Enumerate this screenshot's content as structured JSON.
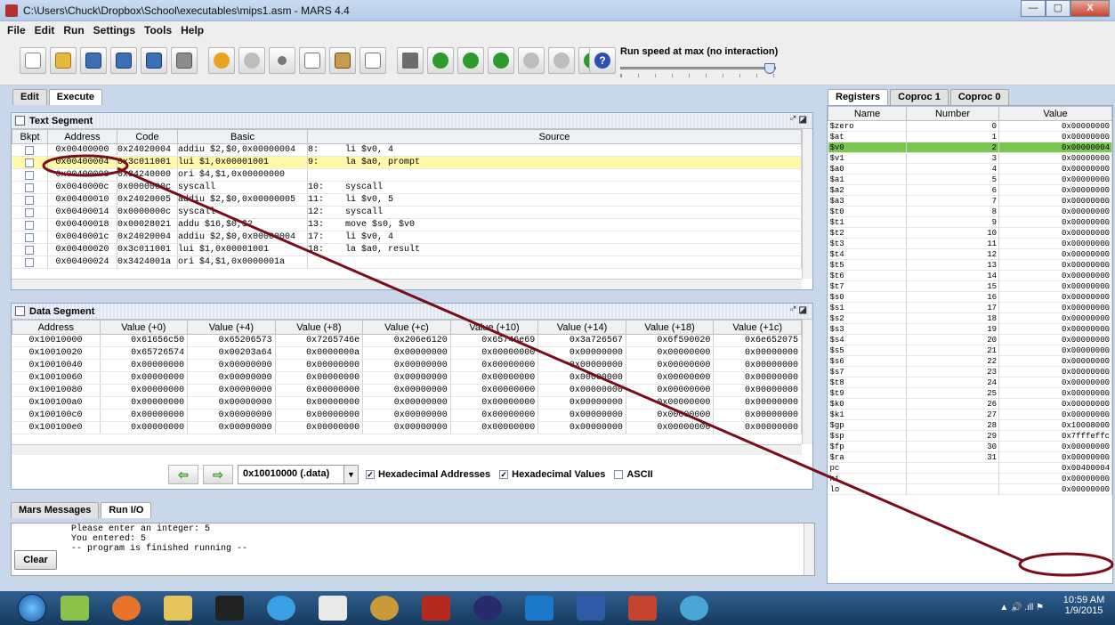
{
  "window": {
    "title": "C:\\Users\\Chuck\\Dropbox\\School\\executables\\mips1.asm  - MARS 4.4",
    "btn_min": "—",
    "btn_max": "▢",
    "btn_close": "X"
  },
  "menu": [
    "File",
    "Edit",
    "Run",
    "Settings",
    "Tools",
    "Help"
  ],
  "toolbar": {
    "speed_label": "Run speed at max (no interaction)",
    "speed_level": 0.95,
    "help_glyph": "?",
    "icons": [
      "new-icon",
      "open-icon",
      "save-icon",
      "save-all-icon",
      "dump-icon",
      "print-icon",
      "undo-icon",
      "redo-icon",
      "cut-icon",
      "copy-icon",
      "paste-icon",
      "find-replace-icon",
      "assemble-icon",
      "run-icon",
      "step-icon",
      "backstep-icon",
      "pause-icon",
      "stop-icon",
      "reset-icon",
      "help-icon"
    ]
  },
  "main_tabs": {
    "edit": "Edit",
    "execute": "Execute"
  },
  "text_segment": {
    "title": "Text Segment",
    "corner": "▫˟ ◪",
    "headers": {
      "bkpt": "Bkpt",
      "address": "Address",
      "code": "Code",
      "basic": "Basic",
      "source": "Source"
    },
    "rows": [
      {
        "address": "0x00400000",
        "code": "0x24020004",
        "basic": "addiu $2,$0,0x00000004",
        "source": "8:     li $v0, 4"
      },
      {
        "address": "0x00400004",
        "code": "0x3c011001",
        "basic": "lui $1,0x00001001",
        "source": "9:     la $a0, prompt"
      },
      {
        "address": "0x00400008",
        "code": "0x34240000",
        "basic": "ori $4,$1,0x00000000",
        "source": ""
      },
      {
        "address": "0x0040000c",
        "code": "0x0000000c",
        "basic": "syscall",
        "source": "10:    syscall"
      },
      {
        "address": "0x00400010",
        "code": "0x24020005",
        "basic": "addiu $2,$0,0x00000005",
        "source": "11:    li $v0, 5"
      },
      {
        "address": "0x00400014",
        "code": "0x0000000c",
        "basic": "syscall",
        "source": "12:    syscall"
      },
      {
        "address": "0x00400018",
        "code": "0x00028021",
        "basic": "addu $16,$0,$2",
        "source": "13:    move $s0, $v0"
      },
      {
        "address": "0x0040001c",
        "code": "0x24020004",
        "basic": "addiu $2,$0,0x00000004",
        "source": "17:    li $v0, 4"
      },
      {
        "address": "0x00400020",
        "code": "0x3c011001",
        "basic": "lui $1,0x00001001",
        "source": "18:    la $a0, result"
      },
      {
        "address": "0x00400024",
        "code": "0x3424001a",
        "basic": "ori $4,$1,0x0000001a",
        "source": ""
      }
    ],
    "highlighted_row": 1
  },
  "data_segment": {
    "title": "Data Segment",
    "corner": "▫˟ ◪",
    "headers": [
      "Address",
      "Value (+0)",
      "Value (+4)",
      "Value (+8)",
      "Value (+c)",
      "Value (+10)",
      "Value (+14)",
      "Value (+18)",
      "Value (+1c)"
    ],
    "rows": [
      [
        "0x10010000",
        "0x61656c50",
        "0x65206573",
        "0x7265746e",
        "0x206e6120",
        "0x65746e69",
        "0x3a726567",
        "0x6f590020",
        "0x6e652075"
      ],
      [
        "0x10010020",
        "0x65726574",
        "0x00203a64",
        "0x0000000a",
        "0x00000000",
        "0x00000000",
        "0x00000000",
        "0x00000000",
        "0x00000000"
      ],
      [
        "0x10010040",
        "0x00000000",
        "0x00000000",
        "0x00000000",
        "0x00000000",
        "0x00000000",
        "0x00000000",
        "0x00000000",
        "0x00000000"
      ],
      [
        "0x10010060",
        "0x00000000",
        "0x00000000",
        "0x00000000",
        "0x00000000",
        "0x00000000",
        "0x00000000",
        "0x00000000",
        "0x00000000"
      ],
      [
        "0x10010080",
        "0x00000000",
        "0x00000000",
        "0x00000000",
        "0x00000000",
        "0x00000000",
        "0x00000000",
        "0x00000000",
        "0x00000000"
      ],
      [
        "0x100100a0",
        "0x00000000",
        "0x00000000",
        "0x00000000",
        "0x00000000",
        "0x00000000",
        "0x00000000",
        "0x00000000",
        "0x00000000"
      ],
      [
        "0x100100c0",
        "0x00000000",
        "0x00000000",
        "0x00000000",
        "0x00000000",
        "0x00000000",
        "0x00000000",
        "0x00000000",
        "0x00000000"
      ],
      [
        "0x100100e0",
        "0x00000000",
        "0x00000000",
        "0x00000000",
        "0x00000000",
        "0x00000000",
        "0x00000000",
        "0x00000000",
        "0x00000000"
      ]
    ],
    "nav_prev": "⇦",
    "nav_next": "⇨",
    "combo_value": "0x10010000 (.data)",
    "hex_addresses_label": "Hexadecimal Addresses",
    "hex_addresses": true,
    "hex_values_label": "Hexadecimal Values",
    "hex_values": true,
    "ascii_label": "ASCII",
    "ascii": false
  },
  "messages": {
    "tabs": {
      "mars": "Mars Messages",
      "runio": "Run I/O"
    },
    "clear_label": "Clear",
    "lines": [
      "Please enter an integer: 5",
      "You entered: 5",
      "-- program is finished running --"
    ]
  },
  "registers": {
    "tabs": {
      "registers": "Registers",
      "coproc1": "Coproc 1",
      "coproc0": "Coproc 0"
    },
    "headers": {
      "name": "Name",
      "number": "Number",
      "value": "Value"
    },
    "rows": [
      {
        "name": "$zero",
        "number": "0",
        "value": "0x00000000"
      },
      {
        "name": "$at",
        "number": "1",
        "value": "0x00000000"
      },
      {
        "name": "$v0",
        "number": "2",
        "value": "0x00000004"
      },
      {
        "name": "$v1",
        "number": "3",
        "value": "0x00000000"
      },
      {
        "name": "$a0",
        "number": "4",
        "value": "0x00000000"
      },
      {
        "name": "$a1",
        "number": "5",
        "value": "0x00000000"
      },
      {
        "name": "$a2",
        "number": "6",
        "value": "0x00000000"
      },
      {
        "name": "$a3",
        "number": "7",
        "value": "0x00000000"
      },
      {
        "name": "$t0",
        "number": "8",
        "value": "0x00000000"
      },
      {
        "name": "$t1",
        "number": "9",
        "value": "0x00000000"
      },
      {
        "name": "$t2",
        "number": "10",
        "value": "0x00000000"
      },
      {
        "name": "$t3",
        "number": "11",
        "value": "0x00000000"
      },
      {
        "name": "$t4",
        "number": "12",
        "value": "0x00000000"
      },
      {
        "name": "$t5",
        "number": "13",
        "value": "0x00000000"
      },
      {
        "name": "$t6",
        "number": "14",
        "value": "0x00000000"
      },
      {
        "name": "$t7",
        "number": "15",
        "value": "0x00000000"
      },
      {
        "name": "$s0",
        "number": "16",
        "value": "0x00000000"
      },
      {
        "name": "$s1",
        "number": "17",
        "value": "0x00000000"
      },
      {
        "name": "$s2",
        "number": "18",
        "value": "0x00000000"
      },
      {
        "name": "$s3",
        "number": "19",
        "value": "0x00000000"
      },
      {
        "name": "$s4",
        "number": "20",
        "value": "0x00000000"
      },
      {
        "name": "$s5",
        "number": "21",
        "value": "0x00000000"
      },
      {
        "name": "$s6",
        "number": "22",
        "value": "0x00000000"
      },
      {
        "name": "$s7",
        "number": "23",
        "value": "0x00000000"
      },
      {
        "name": "$t8",
        "number": "24",
        "value": "0x00000000"
      },
      {
        "name": "$t9",
        "number": "25",
        "value": "0x00000000"
      },
      {
        "name": "$k0",
        "number": "26",
        "value": "0x00000000"
      },
      {
        "name": "$k1",
        "number": "27",
        "value": "0x00000000"
      },
      {
        "name": "$gp",
        "number": "28",
        "value": "0x10008000"
      },
      {
        "name": "$sp",
        "number": "29",
        "value": "0x7fffeffc"
      },
      {
        "name": "$fp",
        "number": "30",
        "value": "0x00000000"
      },
      {
        "name": "$ra",
        "number": "31",
        "value": "0x00000000"
      },
      {
        "name": "pc",
        "number": "",
        "value": "0x00400004"
      },
      {
        "name": "hi",
        "number": "",
        "value": "0x00000000"
      },
      {
        "name": "lo",
        "number": "",
        "value": "0x00000000"
      }
    ],
    "highlighted_row": 2
  },
  "taskbar": {
    "time": "10:59 AM",
    "date": "1/9/2015",
    "tray_icons": "▲  🔊  .ıll  ⚑",
    "apps": [
      "start-icon",
      "notepad-plus-icon",
      "firefox-icon",
      "explorer-icon",
      "cmd-icon",
      "ie-icon",
      "solitaire-icon",
      "mars-icon",
      "filezilla-icon",
      "eclipse-icon",
      "virtualbox-icon",
      "word-icon",
      "photo-icon",
      "paint-icon"
    ]
  },
  "annotation_color": "#7a0d1a"
}
